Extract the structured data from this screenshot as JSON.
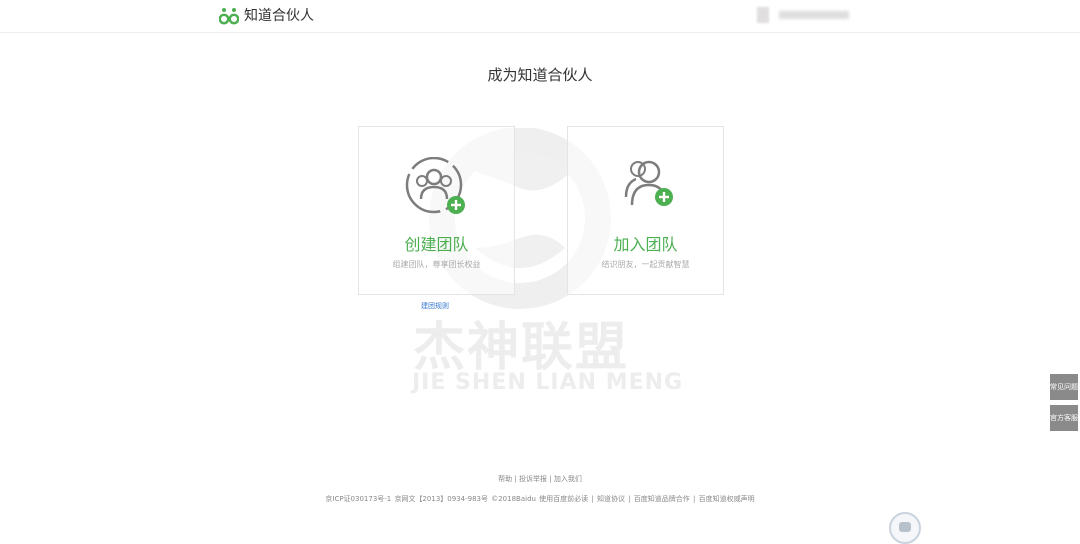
{
  "header": {
    "logo_text": "知道合伙人",
    "brand_color": "#4caf50"
  },
  "main": {
    "title": "成为知道合伙人",
    "cards": [
      {
        "icon": "create-team-icon",
        "title": "创建团队",
        "description": "组建团队，尊享团长权益"
      },
      {
        "icon": "join-team-icon",
        "title": "加入团队",
        "description": "结识朋友，一起贡献智慧"
      }
    ],
    "rules_link": "建团规则"
  },
  "watermark": {
    "cn": "杰神联盟",
    "en": "JIE SHEN LIAN MENG"
  },
  "footer": {
    "links": [
      "帮助",
      "投诉举报",
      "加入我们"
    ],
    "separator": "|",
    "copyright": "京ICP证030173号-1   京网文【2013】0934-983号    ©2018Baidu  使用百度前必读 | 知道协议 | 百度知道品牌合作 | 百度知道权威声明"
  },
  "sidebar_float": {
    "faq": "常见问题",
    "service": "官方客服"
  }
}
